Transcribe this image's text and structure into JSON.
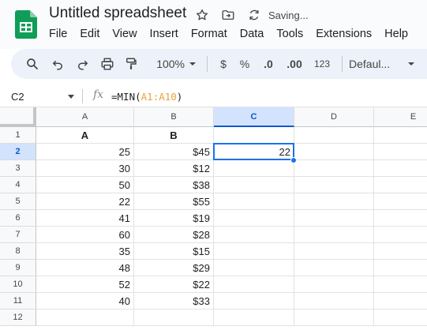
{
  "app": {
    "title": "Untitled spreadsheet",
    "status": "Saving...",
    "brand_color": "#0f9d58",
    "selection_color": "#1a73e8"
  },
  "menu": [
    "File",
    "Edit",
    "View",
    "Insert",
    "Format",
    "Data",
    "Tools",
    "Extensions",
    "Help"
  ],
  "toolbar": {
    "zoom": "100%",
    "currency": "$",
    "percent": "%",
    "decrease_decimal": ".0",
    "increase_decimal": ".00",
    "number_format": "123",
    "font": "Defaul..."
  },
  "formula_bar": {
    "name_box": "C2",
    "fx": "fx",
    "formula_prefix": "=MIN(",
    "formula_range": "A1:A10",
    "formula_suffix": ")"
  },
  "sheet": {
    "columns": [
      "A",
      "B",
      "C",
      "D",
      "E"
    ],
    "rows": [
      "1",
      "2",
      "3",
      "4",
      "5",
      "6",
      "7",
      "8",
      "9",
      "10",
      "11",
      "12"
    ],
    "selected_cell": "C2",
    "cells": {
      "A1": "A",
      "B1": "B",
      "A2": "25",
      "B2": "$45",
      "C2": "22",
      "A3": "30",
      "B3": "$12",
      "A4": "50",
      "B4": "$38",
      "A5": "22",
      "B5": "$55",
      "A6": "41",
      "B6": "$19",
      "A7": "60",
      "B7": "$28",
      "A8": "35",
      "B8": "$15",
      "A9": "48",
      "B9": "$29",
      "A10": "52",
      "B10": "$22",
      "A11": "40",
      "B11": "$33"
    }
  }
}
